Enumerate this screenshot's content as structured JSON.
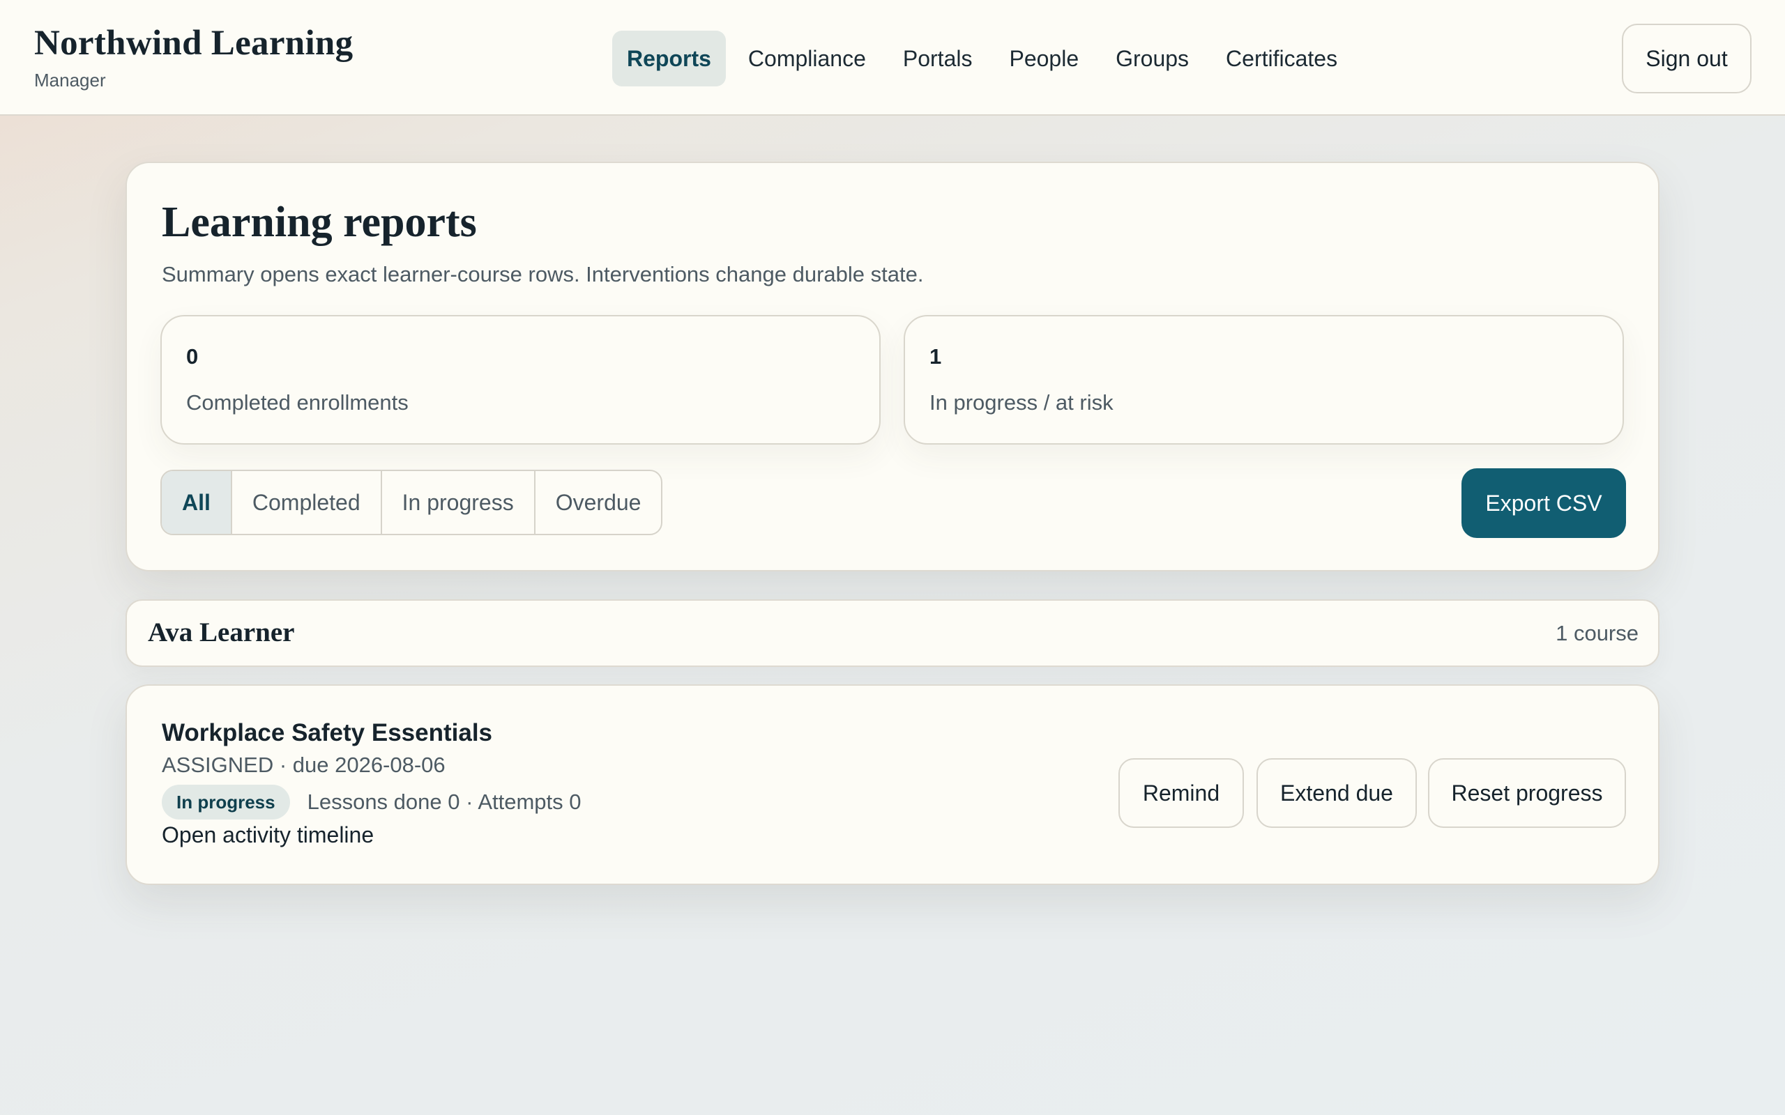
{
  "header": {
    "brand": "Northwind Learning",
    "role": "Manager",
    "nav": [
      {
        "label": "Reports",
        "active": true
      },
      {
        "label": "Compliance",
        "active": false
      },
      {
        "label": "Portals",
        "active": false
      },
      {
        "label": "People",
        "active": false
      },
      {
        "label": "Groups",
        "active": false
      },
      {
        "label": "Certificates",
        "active": false
      }
    ],
    "sign_out_label": "Sign out"
  },
  "reports": {
    "title": "Learning reports",
    "subtitle": "Summary opens exact learner-course rows. Interventions change durable state.",
    "stats": [
      {
        "value": "0",
        "label": "Completed enrollments"
      },
      {
        "value": "1",
        "label": "In progress / at risk"
      }
    ],
    "filters": [
      {
        "label": "All",
        "active": true
      },
      {
        "label": "Completed",
        "active": false
      },
      {
        "label": "In progress",
        "active": false
      },
      {
        "label": "Overdue",
        "active": false
      }
    ],
    "export_label": "Export CSV"
  },
  "learner": {
    "name": "Ava Learner",
    "course_count": "1 course",
    "course": {
      "title": "Workplace Safety Essentials",
      "meta": "ASSIGNED · due 2026-08-06",
      "status_badge": "In progress",
      "progress": "Lessons done 0 · Attempts 0",
      "timeline_link": "Open activity timeline",
      "actions": {
        "remind": "Remind",
        "extend": "Extend due",
        "reset": "Reset progress"
      }
    }
  },
  "colors": {
    "accent": "#115e72",
    "active_tab_bg": "#e2e8e4",
    "badge_bg": "#e2e9e6",
    "card_bg": "#fdfcf6"
  }
}
